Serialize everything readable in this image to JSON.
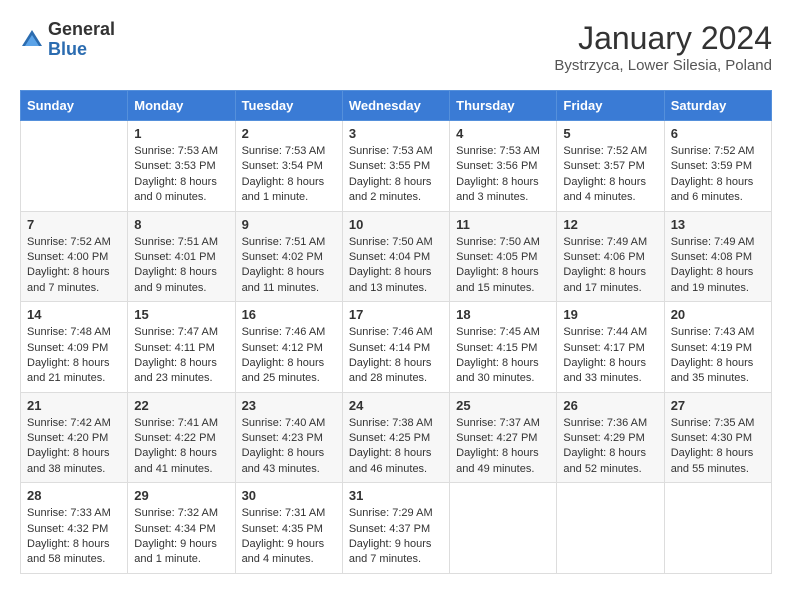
{
  "header": {
    "logo_general": "General",
    "logo_blue": "Blue",
    "month": "January 2024",
    "location": "Bystrzyca, Lower Silesia, Poland"
  },
  "days_of_week": [
    "Sunday",
    "Monday",
    "Tuesday",
    "Wednesday",
    "Thursday",
    "Friday",
    "Saturday"
  ],
  "weeks": [
    [
      {
        "day": "",
        "info": ""
      },
      {
        "day": "1",
        "info": "Sunrise: 7:53 AM\nSunset: 3:53 PM\nDaylight: 8 hours\nand 0 minutes."
      },
      {
        "day": "2",
        "info": "Sunrise: 7:53 AM\nSunset: 3:54 PM\nDaylight: 8 hours\nand 1 minute."
      },
      {
        "day": "3",
        "info": "Sunrise: 7:53 AM\nSunset: 3:55 PM\nDaylight: 8 hours\nand 2 minutes."
      },
      {
        "day": "4",
        "info": "Sunrise: 7:53 AM\nSunset: 3:56 PM\nDaylight: 8 hours\nand 3 minutes."
      },
      {
        "day": "5",
        "info": "Sunrise: 7:52 AM\nSunset: 3:57 PM\nDaylight: 8 hours\nand 4 minutes."
      },
      {
        "day": "6",
        "info": "Sunrise: 7:52 AM\nSunset: 3:59 PM\nDaylight: 8 hours\nand 6 minutes."
      }
    ],
    [
      {
        "day": "7",
        "info": "Sunrise: 7:52 AM\nSunset: 4:00 PM\nDaylight: 8 hours\nand 7 minutes."
      },
      {
        "day": "8",
        "info": "Sunrise: 7:51 AM\nSunset: 4:01 PM\nDaylight: 8 hours\nand 9 minutes."
      },
      {
        "day": "9",
        "info": "Sunrise: 7:51 AM\nSunset: 4:02 PM\nDaylight: 8 hours\nand 11 minutes."
      },
      {
        "day": "10",
        "info": "Sunrise: 7:50 AM\nSunset: 4:04 PM\nDaylight: 8 hours\nand 13 minutes."
      },
      {
        "day": "11",
        "info": "Sunrise: 7:50 AM\nSunset: 4:05 PM\nDaylight: 8 hours\nand 15 minutes."
      },
      {
        "day": "12",
        "info": "Sunrise: 7:49 AM\nSunset: 4:06 PM\nDaylight: 8 hours\nand 17 minutes."
      },
      {
        "day": "13",
        "info": "Sunrise: 7:49 AM\nSunset: 4:08 PM\nDaylight: 8 hours\nand 19 minutes."
      }
    ],
    [
      {
        "day": "14",
        "info": "Sunrise: 7:48 AM\nSunset: 4:09 PM\nDaylight: 8 hours\nand 21 minutes."
      },
      {
        "day": "15",
        "info": "Sunrise: 7:47 AM\nSunset: 4:11 PM\nDaylight: 8 hours\nand 23 minutes."
      },
      {
        "day": "16",
        "info": "Sunrise: 7:46 AM\nSunset: 4:12 PM\nDaylight: 8 hours\nand 25 minutes."
      },
      {
        "day": "17",
        "info": "Sunrise: 7:46 AM\nSunset: 4:14 PM\nDaylight: 8 hours\nand 28 minutes."
      },
      {
        "day": "18",
        "info": "Sunrise: 7:45 AM\nSunset: 4:15 PM\nDaylight: 8 hours\nand 30 minutes."
      },
      {
        "day": "19",
        "info": "Sunrise: 7:44 AM\nSunset: 4:17 PM\nDaylight: 8 hours\nand 33 minutes."
      },
      {
        "day": "20",
        "info": "Sunrise: 7:43 AM\nSunset: 4:19 PM\nDaylight: 8 hours\nand 35 minutes."
      }
    ],
    [
      {
        "day": "21",
        "info": "Sunrise: 7:42 AM\nSunset: 4:20 PM\nDaylight: 8 hours\nand 38 minutes."
      },
      {
        "day": "22",
        "info": "Sunrise: 7:41 AM\nSunset: 4:22 PM\nDaylight: 8 hours\nand 41 minutes."
      },
      {
        "day": "23",
        "info": "Sunrise: 7:40 AM\nSunset: 4:23 PM\nDaylight: 8 hours\nand 43 minutes."
      },
      {
        "day": "24",
        "info": "Sunrise: 7:38 AM\nSunset: 4:25 PM\nDaylight: 8 hours\nand 46 minutes."
      },
      {
        "day": "25",
        "info": "Sunrise: 7:37 AM\nSunset: 4:27 PM\nDaylight: 8 hours\nand 49 minutes."
      },
      {
        "day": "26",
        "info": "Sunrise: 7:36 AM\nSunset: 4:29 PM\nDaylight: 8 hours\nand 52 minutes."
      },
      {
        "day": "27",
        "info": "Sunrise: 7:35 AM\nSunset: 4:30 PM\nDaylight: 8 hours\nand 55 minutes."
      }
    ],
    [
      {
        "day": "28",
        "info": "Sunrise: 7:33 AM\nSunset: 4:32 PM\nDaylight: 8 hours\nand 58 minutes."
      },
      {
        "day": "29",
        "info": "Sunrise: 7:32 AM\nSunset: 4:34 PM\nDaylight: 9 hours\nand 1 minute."
      },
      {
        "day": "30",
        "info": "Sunrise: 7:31 AM\nSunset: 4:35 PM\nDaylight: 9 hours\nand 4 minutes."
      },
      {
        "day": "31",
        "info": "Sunrise: 7:29 AM\nSunset: 4:37 PM\nDaylight: 9 hours\nand 7 minutes."
      },
      {
        "day": "",
        "info": ""
      },
      {
        "day": "",
        "info": ""
      },
      {
        "day": "",
        "info": ""
      }
    ]
  ]
}
